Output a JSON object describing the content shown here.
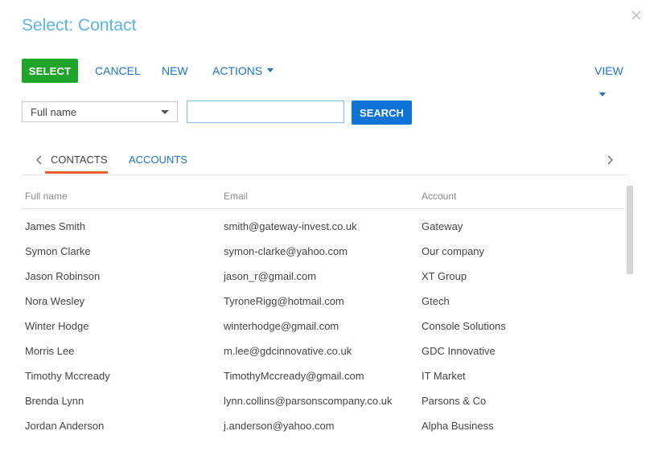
{
  "dialog": {
    "title": "Select: Contact"
  },
  "toolbar": {
    "select_label": "SELECT",
    "cancel_label": "CANCEL",
    "new_label": "NEW",
    "actions_label": "ACTIONS",
    "view_label": "VIEW"
  },
  "filter": {
    "column_value": "Full name",
    "search_value": "",
    "search_button": "SEARCH"
  },
  "tabs": [
    {
      "label": "CONTACTS",
      "active": true
    },
    {
      "label": "ACCOUNTS",
      "active": false
    }
  ],
  "grid": {
    "columns": [
      "Full name",
      "Email",
      "Account"
    ],
    "rows": [
      {
        "name": "James Smith",
        "email": "smith@gateway-invest.co.uk",
        "account": "Gateway"
      },
      {
        "name": "Symon Clarke",
        "email": "symon-clarke@yahoo.com",
        "account": "Our company"
      },
      {
        "name": "Jason Robinson",
        "email": "jason_r@gmail.com",
        "account": "XT Group"
      },
      {
        "name": "Nora Wesley",
        "email": "TyroneRigg@hotmail.com",
        "account": "Gtech"
      },
      {
        "name": "Winter Hodge",
        "email": "winterhodge@gmail.com",
        "account": "Console Solutions"
      },
      {
        "name": "Morris Lee",
        "email": "m.lee@gdcinnovative.co.uk",
        "account": "GDC Innovative"
      },
      {
        "name": "Timothy Mccready",
        "email": "TimothyMccready@gmail.com",
        "account": "IT Market"
      },
      {
        "name": "Brenda Lynn",
        "email": "lynn.collins@parsonscompany.co.uk",
        "account": "Parsons & Co"
      },
      {
        "name": "Jordan Anderson",
        "email": "j.anderson@yahoo.com",
        "account": "Alpha Business"
      }
    ]
  },
  "colors": {
    "title": "#5cb4e2",
    "select_button": "#1fa52a",
    "search_button": "#0e74d8",
    "link": "#1b74c7",
    "active_tab_underline": "#e85c2c"
  },
  "icons": {
    "close": "close-icon",
    "tab_prev": "chevron-left-icon",
    "tab_next": "chevron-right-icon",
    "dropdown": "caret-down-icon"
  }
}
